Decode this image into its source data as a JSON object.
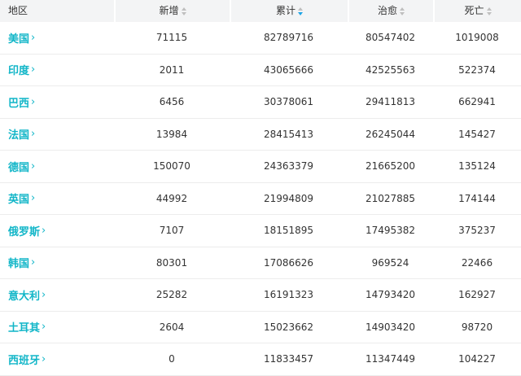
{
  "header": {
    "region": "地区",
    "new": "新增",
    "total": "累计",
    "cured": "治愈",
    "deaths": "死亡"
  },
  "chevron": "›",
  "rows": [
    {
      "region": "美国",
      "new": "71115",
      "total": "82789716",
      "cured": "80547402",
      "deaths": "1019008"
    },
    {
      "region": "印度",
      "new": "2011",
      "total": "43065666",
      "cured": "42525563",
      "deaths": "522374"
    },
    {
      "region": "巴西",
      "new": "6456",
      "total": "30378061",
      "cured": "29411813",
      "deaths": "662941"
    },
    {
      "region": "法国",
      "new": "13984",
      "total": "28415413",
      "cured": "26245044",
      "deaths": "145427"
    },
    {
      "region": "德国",
      "new": "150070",
      "total": "24363379",
      "cured": "21665200",
      "deaths": "135124"
    },
    {
      "region": "英国",
      "new": "44992",
      "total": "21994809",
      "cured": "21027885",
      "deaths": "174144"
    },
    {
      "region": "俄罗斯",
      "new": "7107",
      "total": "18151895",
      "cured": "17495382",
      "deaths": "375237"
    },
    {
      "region": "韩国",
      "new": "80301",
      "total": "17086626",
      "cured": "969524",
      "deaths": "22466"
    },
    {
      "region": "意大利",
      "new": "25282",
      "total": "16191323",
      "cured": "14793420",
      "deaths": "162927"
    },
    {
      "region": "土耳其",
      "new": "2604",
      "total": "15023662",
      "cured": "14903420",
      "deaths": "98720"
    },
    {
      "region": "西班牙",
      "new": "0",
      "total": "11833457",
      "cured": "11347449",
      "deaths": "104227"
    }
  ],
  "colors": {
    "accent": "#12b6c8",
    "sort_active": "#1ca4e6",
    "header_bg": "#f3f4f5"
  }
}
